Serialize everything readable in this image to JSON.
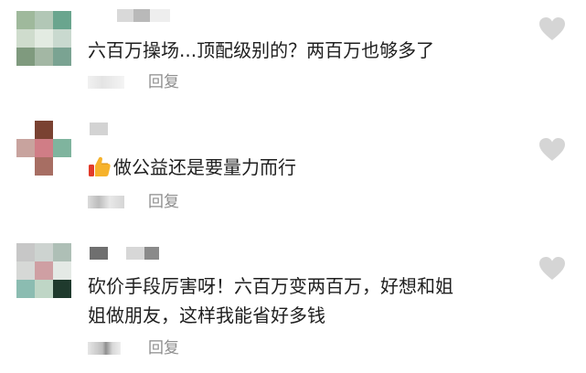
{
  "comments": [
    {
      "text": "六百万操场...顶配级别的？两百万也够多了",
      "has_thumb": false,
      "reply_label": "回复",
      "icon": "heart-icon"
    },
    {
      "text": "做公益还是要量力而行",
      "has_thumb": true,
      "reply_label": "回复",
      "icon": "heart-icon"
    },
    {
      "text_line1": "砍价手段厉害呀！六百万变两百万，好想和姐",
      "text_line2": "姐做朋友，这样我能省好多钱",
      "has_thumb": false,
      "reply_label": "回复",
      "icon": "heart-icon"
    }
  ],
  "colors": {
    "reply": "#8e8e8e",
    "heart": "#d5d5d5",
    "text": "#1f1f1f"
  }
}
